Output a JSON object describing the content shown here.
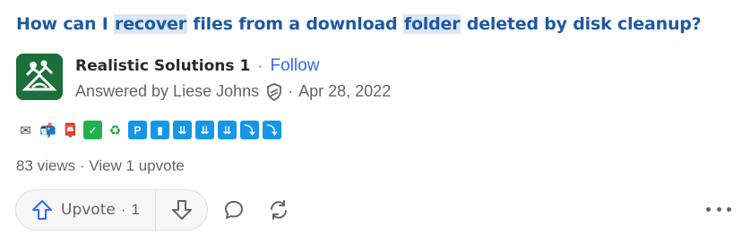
{
  "question": {
    "parts": [
      {
        "text": "How can I ",
        "highlight": false
      },
      {
        "text": "recover",
        "highlight": true
      },
      {
        "text": " files from a download ",
        "highlight": false
      },
      {
        "text": "folder",
        "highlight": true
      },
      {
        "text": " deleted by disk cleanup?",
        "highlight": false
      }
    ]
  },
  "author": {
    "name": "Realistic Solutions 1",
    "separator": "·",
    "follow_label": "Follow"
  },
  "meta": {
    "answered_by": "Answered by Liese Johns",
    "separator": "·",
    "date": "Apr 28, 2022",
    "badge_icon": "shield-icon"
  },
  "emoji_row": [
    {
      "name": "incoming-envelope-icon",
      "glyph": "✉",
      "style": "plain"
    },
    {
      "name": "mailbox-icon",
      "glyph": "📬",
      "style": "plain"
    },
    {
      "name": "postbox-icon",
      "glyph": "📮",
      "style": "plain"
    },
    {
      "name": "check-mark-button-icon",
      "glyph": "✓",
      "style": "green"
    },
    {
      "name": "recycle-icon",
      "glyph": "♻",
      "style": "plain-green"
    },
    {
      "name": "parking-icon",
      "glyph": "P",
      "style": "blue"
    },
    {
      "name": "signal-bars-icon",
      "glyph": "▮",
      "style": "blue"
    },
    {
      "name": "down-arrow-button-icon",
      "glyph": "⇊",
      "style": "blue"
    },
    {
      "name": "down-arrow-button-icon",
      "glyph": "⇊",
      "style": "blue"
    },
    {
      "name": "down-arrow-button-icon",
      "glyph": "⇊",
      "style": "blue"
    },
    {
      "name": "return-arrow-icon",
      "glyph": "⤵",
      "style": "blue"
    },
    {
      "name": "return-arrow-icon",
      "glyph": "⤵",
      "style": "blue"
    }
  ],
  "stats": {
    "views": "83 views",
    "separator": "·",
    "upvote_link": "View 1 upvote"
  },
  "actions": {
    "upvote_label": "Upvote",
    "upvote_separator": "·",
    "upvote_count": "1"
  },
  "colors": {
    "title": "#1e5aa0",
    "highlight": "#dbe6f6",
    "link": "#2e69ff",
    "upvote_icon": "#2e69ff",
    "muted": "#636466",
    "avatar_bg": "#1b6f3a"
  }
}
